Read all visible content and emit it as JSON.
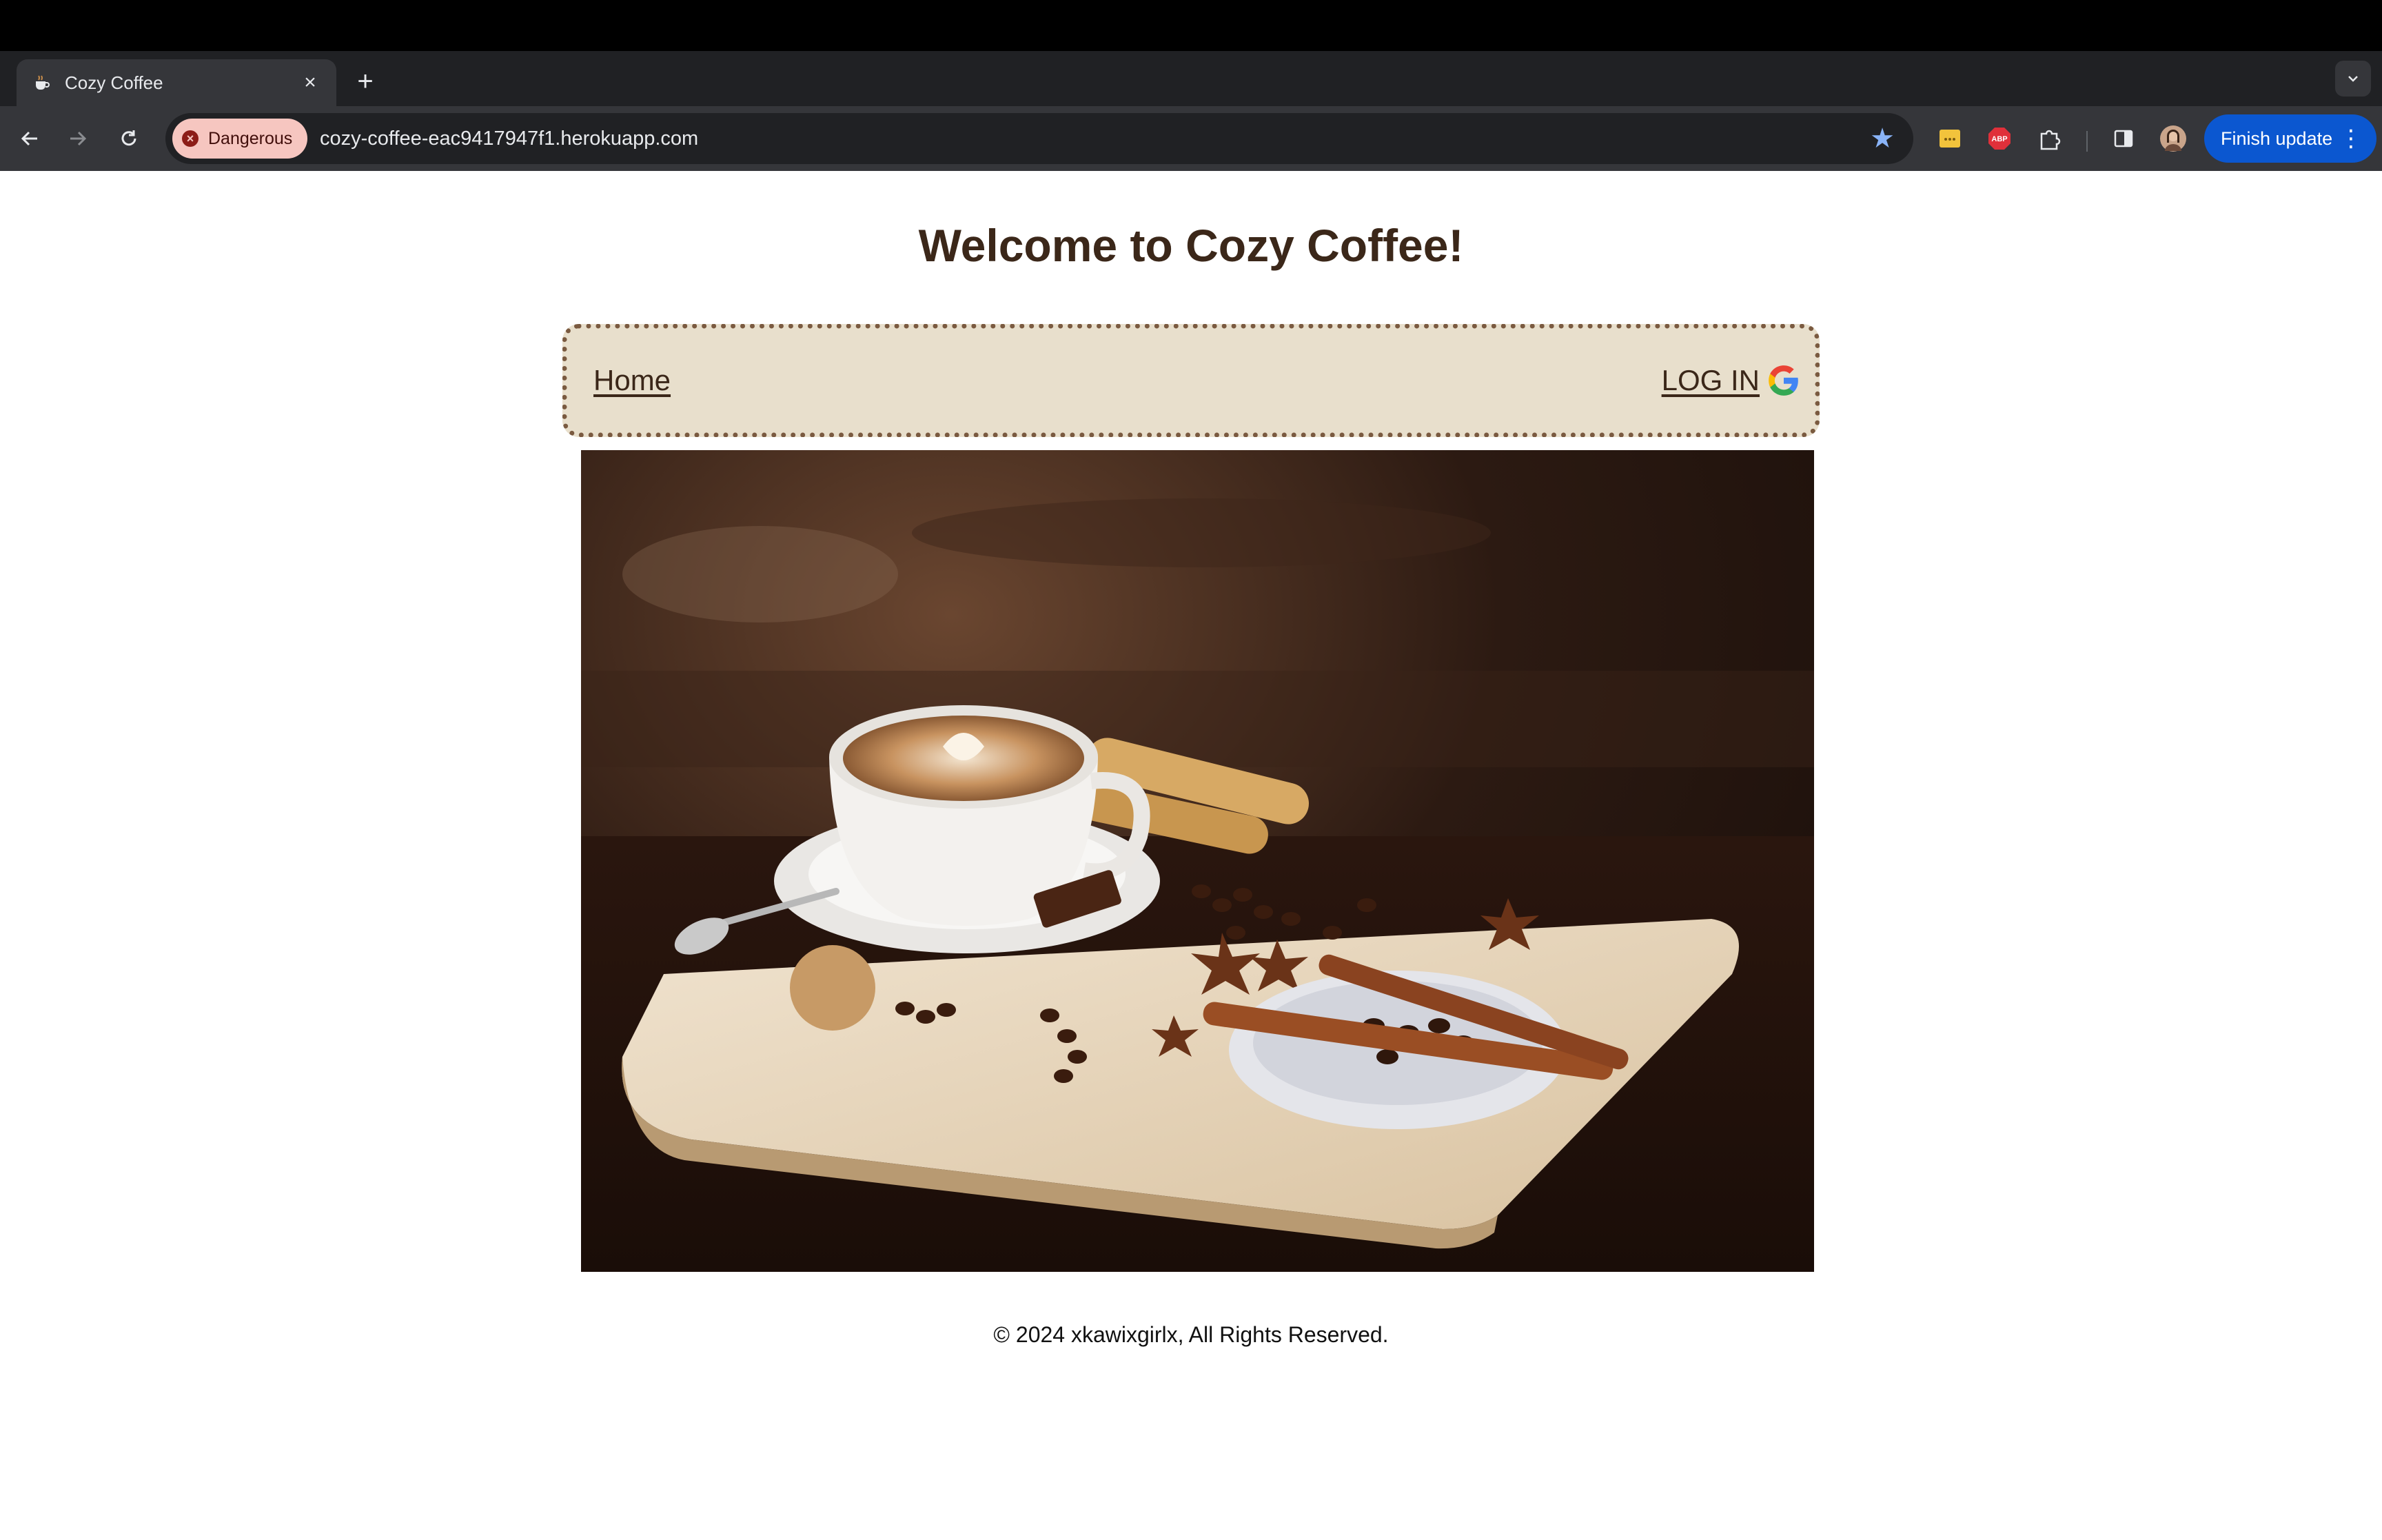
{
  "browser": {
    "tab_title": "Cozy Coffee",
    "tab_close_glyph": "×",
    "new_tab_glyph": "+",
    "security_label": "Dangerous",
    "url": "cozy-coffee-eac9417947f1.herokuapp.com",
    "finish_update_label": "Finish update",
    "icons": [
      "back-icon",
      "forward-icon",
      "reload-icon",
      "bookmark-star-icon",
      "extension-icon",
      "puzzle-icon",
      "side-panel-icon",
      "profile-avatar",
      "tab-search-icon"
    ]
  },
  "page": {
    "heading": "Welcome to Cozy Coffee!",
    "nav": {
      "home_label": "Home",
      "login_label": "LOG IN"
    },
    "hero_alt": "Cappuccino on a wooden board with coffee beans, star anise and cinnamon",
    "footer": "© 2024 xkawixgirlx, All Rights Reserved."
  },
  "colors": {
    "heading": "#3b2719",
    "navbar_bg": "#e8dfcc",
    "navbar_border": "#7a5a40",
    "danger_chip": "#f6c6c0",
    "update_button": "#0b57d0"
  }
}
